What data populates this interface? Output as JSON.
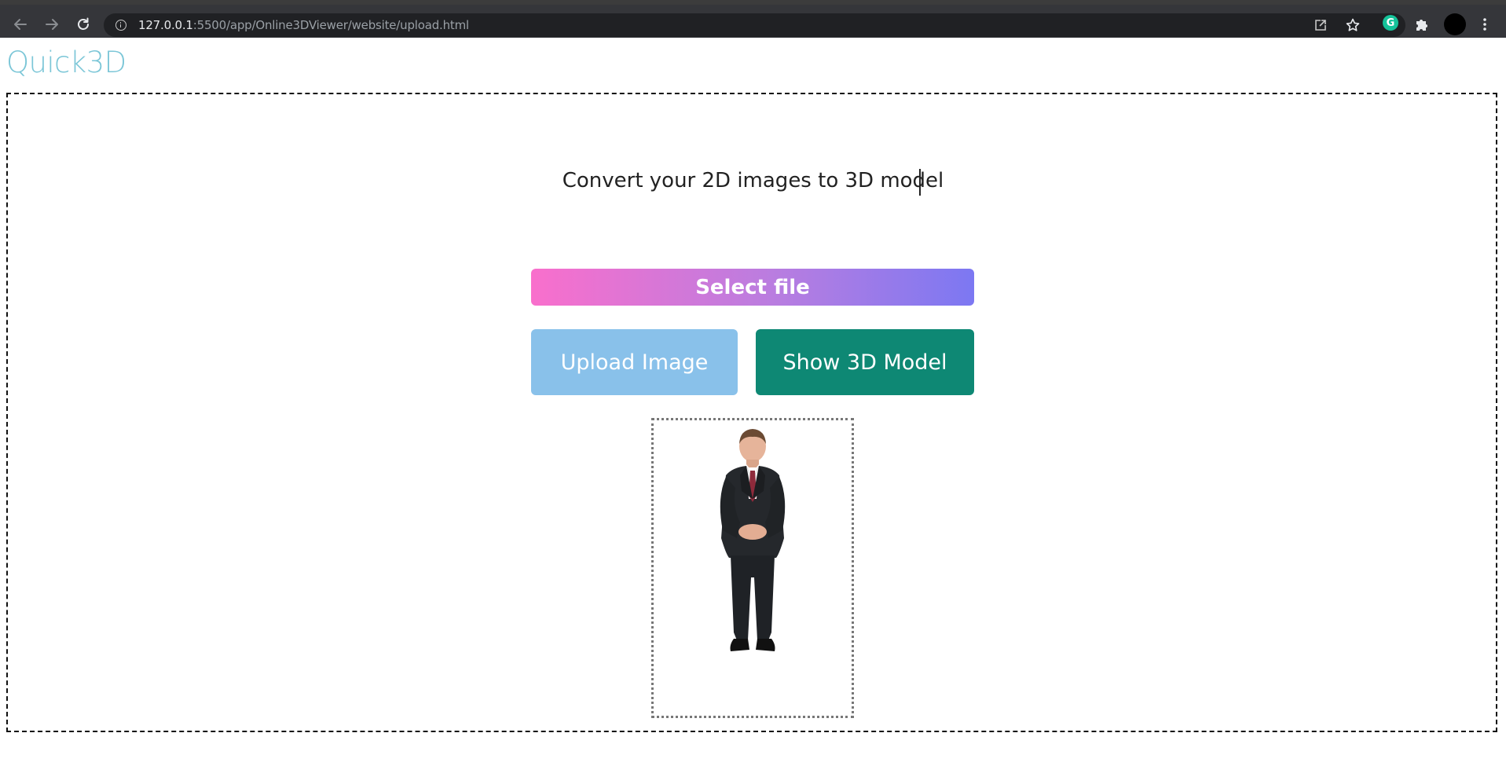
{
  "browser": {
    "url_host": "127.0.0.1",
    "url_rest": ":5500/app/Online3DViewer/website/upload.html",
    "extension_badge": "G",
    "icons": [
      "back-arrow-icon",
      "forward-arrow-icon",
      "reload-icon",
      "site-info-icon",
      "share-icon",
      "bookmark-star-icon",
      "grammarly-icon",
      "extensions-puzzle-icon",
      "profile-avatar",
      "kebab-menu-icon"
    ]
  },
  "page": {
    "logo": "Quick3D",
    "headline": "Convert your 2D images to 3D model",
    "select_label": "Select file",
    "upload_label": "Upload Image",
    "show_label": "Show 3D Model"
  },
  "colors": {
    "logo": "#7bc6d7",
    "select_gradient_start": "#f96fcc",
    "select_gradient_end": "#7c78f2",
    "upload_button": "#89c1ea",
    "show_button": "#0e8874"
  }
}
